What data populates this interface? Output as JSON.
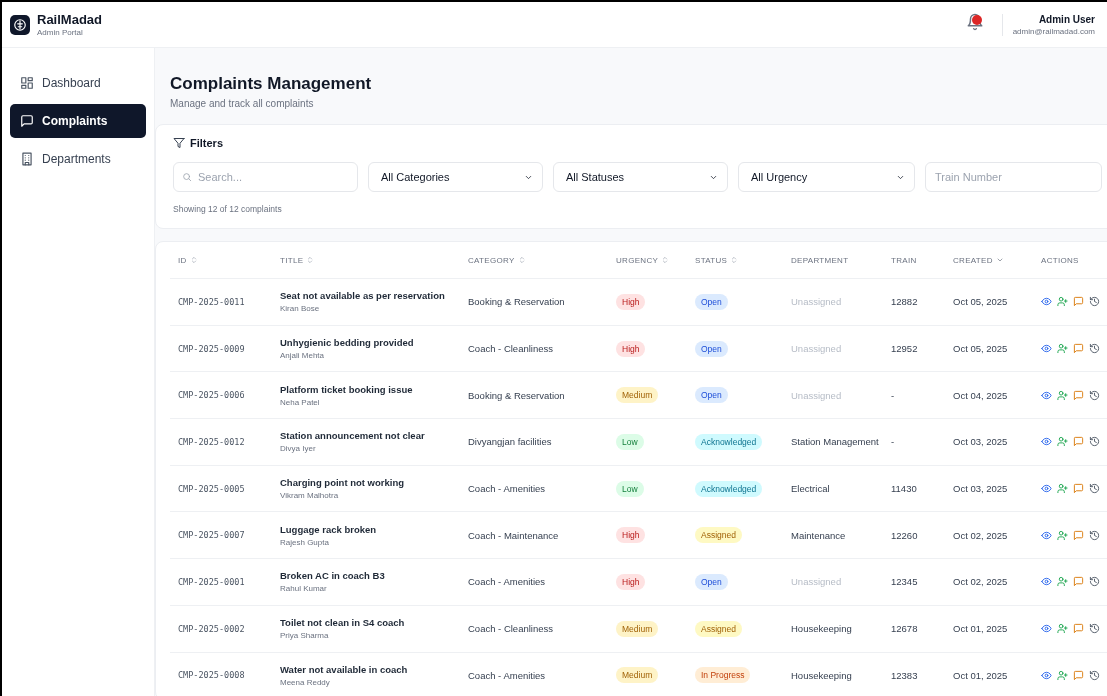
{
  "brand": {
    "name": "RailMadad",
    "subtitle": "Admin Portal"
  },
  "user": {
    "name": "Admin User",
    "email": "admin@railmadad.com",
    "has_notifications": true
  },
  "sidebar": {
    "items": [
      {
        "label": "Dashboard",
        "kind": "grid",
        "selected": false
      },
      {
        "label": "Complaints",
        "kind": "message",
        "selected": true
      },
      {
        "label": "Departments",
        "kind": "building",
        "selected": false
      }
    ]
  },
  "page": {
    "title": "Complaints Management",
    "subtitle": "Manage and track all complaints"
  },
  "filters": {
    "title": "Filters",
    "search_placeholder": "Search...",
    "selects": [
      "All Categories",
      "All Statuses",
      "All Urgency"
    ],
    "train_placeholder": "Train Number",
    "summary": "Showing 12 of 12 complaints"
  },
  "table": {
    "columns": [
      {
        "label": "ID",
        "sortable": true,
        "sorted": false
      },
      {
        "label": "TITLE",
        "sortable": true,
        "sorted": false
      },
      {
        "label": "CATEGORY",
        "sortable": true,
        "sorted": false
      },
      {
        "label": "URGENCY",
        "sortable": true,
        "sorted": false
      },
      {
        "label": "STATUS",
        "sortable": true,
        "sorted": false
      },
      {
        "label": "DEPARTMENT",
        "sortable": false,
        "sorted": false
      },
      {
        "label": "TRAIN",
        "sortable": false,
        "sorted": false
      },
      {
        "label": "CREATED",
        "sortable": true,
        "sorted": true
      },
      {
        "label": "ACTIONS",
        "sortable": false,
        "sorted": false
      }
    ],
    "rows": [
      {
        "id": "CMP-2025-0011",
        "title": "Seat not available as per reservation",
        "reporter": "Kiran Bose",
        "category": "Booking & Reservation",
        "urgency": {
          "label": "High",
          "kind": "high"
        },
        "status": {
          "label": "Open",
          "kind": "open"
        },
        "department": {
          "name": "Unassigned",
          "assigned": false
        },
        "train": "12882",
        "created": "Oct 05, 2025"
      },
      {
        "id": "CMP-2025-0009",
        "title": "Unhygienic bedding provided",
        "reporter": "Anjali Mehta",
        "category": "Coach - Cleanliness",
        "urgency": {
          "label": "High",
          "kind": "high"
        },
        "status": {
          "label": "Open",
          "kind": "open"
        },
        "department": {
          "name": "Unassigned",
          "assigned": false
        },
        "train": "12952",
        "created": "Oct 05, 2025"
      },
      {
        "id": "CMP-2025-0006",
        "title": "Platform ticket booking issue",
        "reporter": "Neha Patel",
        "category": "Booking & Reservation",
        "urgency": {
          "label": "Medium",
          "kind": "medium"
        },
        "status": {
          "label": "Open",
          "kind": "open"
        },
        "department": {
          "name": "Unassigned",
          "assigned": false
        },
        "train": "-",
        "created": "Oct 04, 2025"
      },
      {
        "id": "CMP-2025-0012",
        "title": "Station announcement not clear",
        "reporter": "Divya Iyer",
        "category": "Divyangjan facilities",
        "urgency": {
          "label": "Low",
          "kind": "low"
        },
        "status": {
          "label": "Acknowledged",
          "kind": "acknowledged"
        },
        "department": {
          "name": "Station Management",
          "assigned": true
        },
        "train": "-",
        "created": "Oct 03, 2025"
      },
      {
        "id": "CMP-2025-0005",
        "title": "Charging point not working",
        "reporter": "Vikram Malhotra",
        "category": "Coach - Amenities",
        "urgency": {
          "label": "Low",
          "kind": "low"
        },
        "status": {
          "label": "Acknowledged",
          "kind": "acknowledged"
        },
        "department": {
          "name": "Electrical",
          "assigned": true
        },
        "train": "11430",
        "created": "Oct 03, 2025"
      },
      {
        "id": "CMP-2025-0007",
        "title": "Luggage rack broken",
        "reporter": "Rajesh Gupta",
        "category": "Coach - Maintenance",
        "urgency": {
          "label": "High",
          "kind": "high"
        },
        "status": {
          "label": "Assigned",
          "kind": "assigned"
        },
        "department": {
          "name": "Maintenance",
          "assigned": true
        },
        "train": "12260",
        "created": "Oct 02, 2025"
      },
      {
        "id": "CMP-2025-0001",
        "title": "Broken AC in coach B3",
        "reporter": "Rahul Kumar",
        "category": "Coach - Amenities",
        "urgency": {
          "label": "High",
          "kind": "high"
        },
        "status": {
          "label": "Open",
          "kind": "open"
        },
        "department": {
          "name": "Unassigned",
          "assigned": false
        },
        "train": "12345",
        "created": "Oct 02, 2025"
      },
      {
        "id": "CMP-2025-0002",
        "title": "Toilet not clean in S4 coach",
        "reporter": "Priya Sharma",
        "category": "Coach - Cleanliness",
        "urgency": {
          "label": "Medium",
          "kind": "medium"
        },
        "status": {
          "label": "Assigned",
          "kind": "assigned"
        },
        "department": {
          "name": "Housekeeping",
          "assigned": true
        },
        "train": "12678",
        "created": "Oct 01, 2025"
      },
      {
        "id": "CMP-2025-0008",
        "title": "Water not available in coach",
        "reporter": "Meena Reddy",
        "category": "Coach - Amenities",
        "urgency": {
          "label": "Medium",
          "kind": "medium"
        },
        "status": {
          "label": "In Progress",
          "kind": "progress"
        },
        "department": {
          "name": "Housekeeping",
          "assigned": true
        },
        "train": "12383",
        "created": "Oct 01, 2025"
      }
    ]
  }
}
